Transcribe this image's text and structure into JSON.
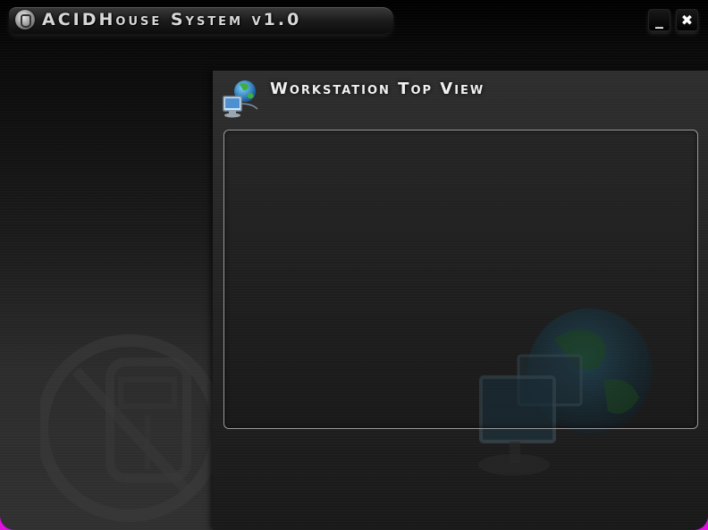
{
  "app": {
    "title": "ACIDHouse System v1.0"
  },
  "window_controls": {
    "minimize_label": "_",
    "close_label": "✖"
  },
  "section": {
    "title": "Workstation Top View",
    "icon": "network-computer-globe-icon"
  },
  "panel": {
    "items": []
  },
  "colors": {
    "window_border": "#e010e0",
    "titlebar_text": "#d8d8d8",
    "section_title_text": "#f0f0f0",
    "panel_border": "#9a9a9a"
  }
}
